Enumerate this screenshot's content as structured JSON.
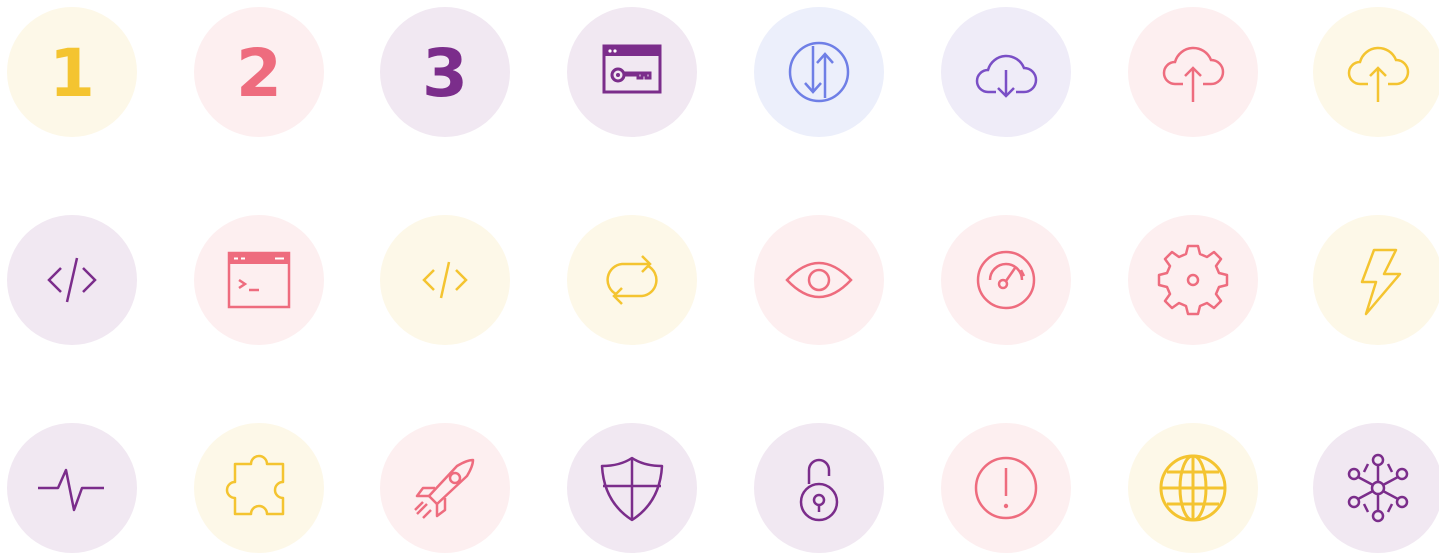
{
  "palette": {
    "yellow": "#f4c430",
    "yellow_bg": "#fdf8e8",
    "pink": "#ee6c7e",
    "pink_bg": "#fdeff0",
    "purple": "#7b2d8b",
    "purple_bg": "#f1e8f2",
    "blue": "#6f7fe6",
    "blue_bg": "#eceffb",
    "violet": "#7a4fc6",
    "violet_bg": "#efecf8"
  },
  "badges": [
    {
      "kind": "digit",
      "label": "1",
      "color": "yellow",
      "name": "step-1-badge"
    },
    {
      "kind": "digit",
      "label": "2",
      "color": "pink",
      "name": "step-2-badge"
    },
    {
      "kind": "digit",
      "label": "3",
      "color": "purple",
      "name": "step-3-badge"
    },
    {
      "kind": "icon",
      "icon": "browser-key-icon",
      "color": "purple"
    },
    {
      "kind": "icon",
      "icon": "up-down-arrows-icon",
      "color": "blue"
    },
    {
      "kind": "icon",
      "icon": "cloud-download-icon",
      "color": "violet"
    },
    {
      "kind": "icon",
      "icon": "cloud-upload-icon",
      "color": "pink"
    },
    {
      "kind": "icon",
      "icon": "cloud-upload-icon",
      "color": "yellow"
    },
    {
      "kind": "icon",
      "icon": "code-brackets-icon",
      "color": "purple"
    },
    {
      "kind": "icon",
      "icon": "terminal-window-icon",
      "color": "pink"
    },
    {
      "kind": "icon",
      "icon": "code-brackets-icon",
      "color": "yellow"
    },
    {
      "kind": "icon",
      "icon": "sync-arrows-icon",
      "color": "yellow"
    },
    {
      "kind": "icon",
      "icon": "eye-icon",
      "color": "pink"
    },
    {
      "kind": "icon",
      "icon": "speedometer-icon",
      "color": "pink"
    },
    {
      "kind": "icon",
      "icon": "gear-icon",
      "color": "pink"
    },
    {
      "kind": "icon",
      "icon": "lightning-bolt-icon",
      "color": "yellow"
    },
    {
      "kind": "icon",
      "icon": "pulse-line-icon",
      "color": "purple"
    },
    {
      "kind": "icon",
      "icon": "puzzle-piece-icon",
      "color": "yellow"
    },
    {
      "kind": "icon",
      "icon": "rocket-icon",
      "color": "pink"
    },
    {
      "kind": "icon",
      "icon": "shield-icon",
      "color": "purple"
    },
    {
      "kind": "icon",
      "icon": "unlocked-padlock-icon",
      "color": "purple"
    },
    {
      "kind": "icon",
      "icon": "alert-circle-icon",
      "color": "pink"
    },
    {
      "kind": "icon",
      "icon": "globe-icon",
      "color": "yellow"
    },
    {
      "kind": "icon",
      "icon": "network-hub-icon",
      "color": "purple"
    }
  ]
}
